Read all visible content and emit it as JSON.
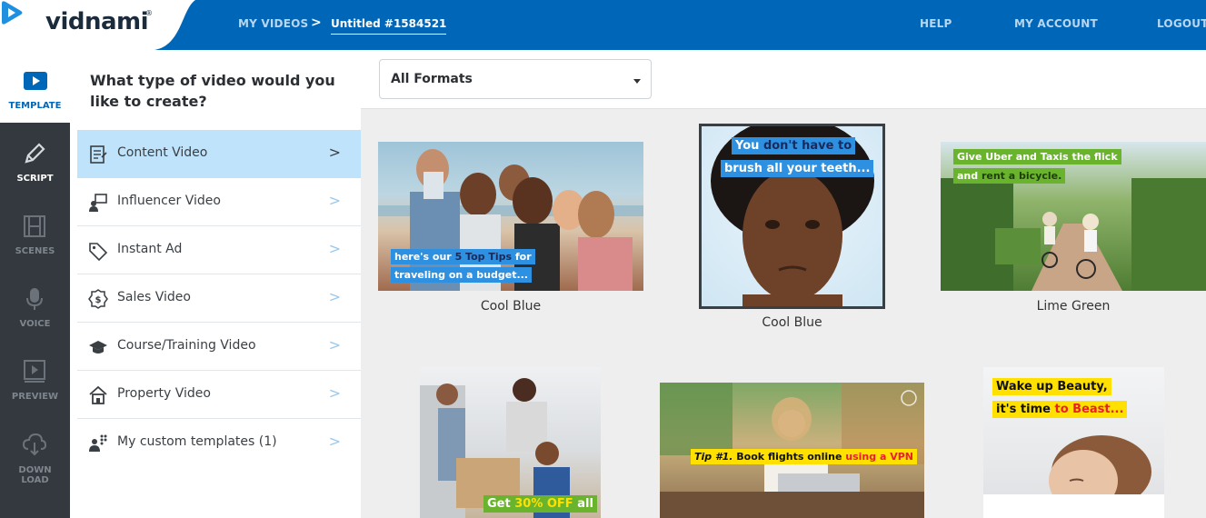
{
  "brand": {
    "name": "vidnami",
    "reg": "®"
  },
  "topnav": {
    "my_videos": "MY VIDEOS",
    "separator": ">",
    "current": "Untitled #1584521",
    "help": "HELP",
    "my_account": "MY ACCOUNT",
    "logout": "LOGOUT"
  },
  "rail": [
    {
      "label": "TEMPLATE",
      "icon": "play-video-icon",
      "active": true
    },
    {
      "label": "SCRIPT",
      "icon": "pencil-icon"
    },
    {
      "label": "SCENES",
      "icon": "film-icon"
    },
    {
      "label": "VOICE",
      "icon": "microphone-icon"
    },
    {
      "label": "PREVIEW",
      "icon": "preview-icon"
    },
    {
      "label": "DOWN",
      "label2": "LOAD",
      "icon": "download-cloud-icon"
    }
  ],
  "categories": {
    "heading": "What type of video would you like to create?",
    "items": [
      {
        "label": "Content Video",
        "icon": "document-icon",
        "active": true
      },
      {
        "label": "Influencer Video",
        "icon": "presenter-icon"
      },
      {
        "label": "Instant Ad",
        "icon": "tag-icon"
      },
      {
        "label": "Sales Video",
        "icon": "dollar-badge-icon"
      },
      {
        "label": "Course/Training Video",
        "icon": "graduation-cap-icon"
      },
      {
        "label": "Property Video",
        "icon": "house-icon"
      },
      {
        "label": "My custom templates (1)",
        "icon": "custom-templates-icon"
      }
    ],
    "chevron": ">"
  },
  "filter": {
    "selected": "All Formats"
  },
  "templates": [
    {
      "caption": "Cool Blue",
      "line1_pre": "here's our ",
      "line1_hl": "5 Top Tips",
      "line1_post": " for",
      "line2": "traveling on a budget..."
    },
    {
      "caption": "Cool Blue",
      "line1_pre": "You ",
      "line1_hl": "don't have to",
      "line2": "brush all your teeth...",
      "selected": true
    },
    {
      "caption": "Lime Green",
      "line1": "Give Uber and Taxis the flick",
      "line2_pre": "and ",
      "line2_hl": "rent a bicycle."
    },
    {
      "caption": "",
      "line1_pre": "Get ",
      "line1_hl": "30% OFF",
      "line1_post": " all"
    },
    {
      "caption": "",
      "line1_pre": "Tip #1. ",
      "line1_mid": "Book flights online ",
      "line1_hl": "using a VPN"
    },
    {
      "caption": "",
      "line1": "Wake up Beauty,",
      "line2_pre": "it's time ",
      "line2_hl": "to Beast..."
    }
  ],
  "colors": {
    "topbar": "#0067b8",
    "rail": "#33393f",
    "active_category": "#bfe3fb",
    "accent_blue": "#2e90e0",
    "accent_green": "#6ab42d",
    "accent_yellow": "#ffe000"
  }
}
